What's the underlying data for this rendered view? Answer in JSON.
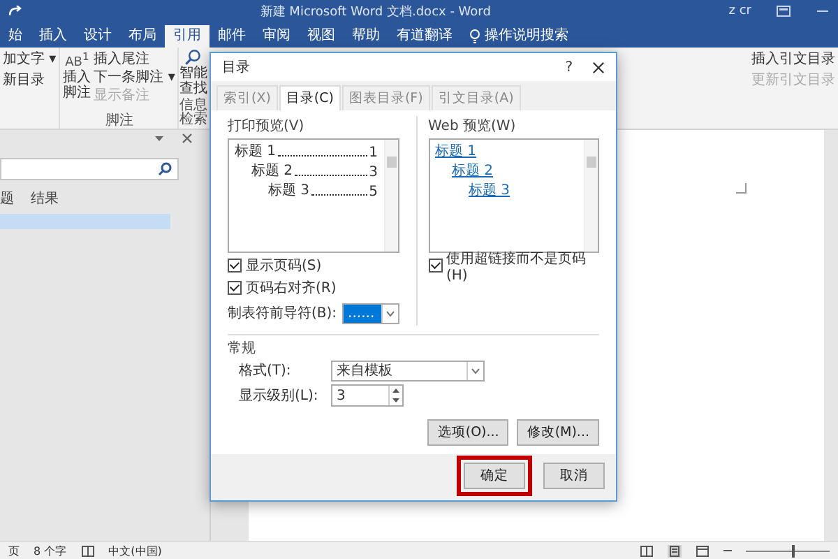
{
  "window": {
    "title": "新建 Microsoft Word 文档.docx  -  Word",
    "user": "z cr"
  },
  "ribbon_tabs": [
    {
      "label": "始",
      "selected": false
    },
    {
      "label": "插入",
      "selected": false
    },
    {
      "label": "设计",
      "selected": false
    },
    {
      "label": "布局",
      "selected": false
    },
    {
      "label": "引用",
      "selected": true
    },
    {
      "label": "邮件",
      "selected": false
    },
    {
      "label": "审阅",
      "selected": false
    },
    {
      "label": "视图",
      "selected": false
    },
    {
      "label": "帮助",
      "selected": false
    },
    {
      "label": "有道翻译",
      "selected": false
    }
  ],
  "tell_me": "操作说明搜索",
  "ribbon": {
    "toc_items": [
      {
        "label": "加文字 ▾",
        "disabled": false
      },
      {
        "label": "新目录",
        "disabled": false
      }
    ],
    "footnote_icon": "AB$^{1}$",
    "footnote_big": "插入脚注",
    "footnote_items": [
      {
        "label": "插入尾注",
        "disabled": false
      },
      {
        "label": "下一条脚注 ▾",
        "disabled": false
      },
      {
        "label": "显示备注",
        "disabled": true
      }
    ],
    "footnote_group": "脚注",
    "lookup": "智能查找",
    "lookup_group": "信息检索",
    "citation_items": [
      {
        "label": "插入引文目录",
        "disabled": false
      },
      {
        "label": "更新引文目录",
        "disabled": true
      }
    ]
  },
  "navigation_pane": {
    "tabs": [
      {
        "label": "题",
        "selected": false
      },
      {
        "label": "结果",
        "selected": false
      }
    ]
  },
  "dialog": {
    "title": "目录",
    "help": "?",
    "tabs": [
      {
        "label": "索引(X)",
        "selected": false
      },
      {
        "label": "目录(C)",
        "selected": true
      },
      {
        "label": "图表目录(F)",
        "selected": false
      },
      {
        "label": "引文目录(A)",
        "selected": false
      }
    ],
    "print_preview": {
      "label": "打印预览(V)",
      "entries": [
        {
          "text": "标题 1",
          "page": "1"
        },
        {
          "text": "标题 2",
          "page": "3"
        },
        {
          "text": "标题 3",
          "page": "5"
        }
      ]
    },
    "web_preview": {
      "label": "Web 预览(W)",
      "entries": [
        "标题 1",
        "标题 2",
        "标题 3"
      ]
    },
    "left_checks": [
      {
        "label": "显示页码(S)",
        "checked": true
      },
      {
        "label": "页码右对齐(R)",
        "checked": true
      }
    ],
    "right_checks": [
      {
        "label": "使用超链接而不是页码(H)",
        "checked": true
      }
    ],
    "leader": {
      "label": "制表符前导符(B):",
      "value": "......"
    },
    "general": {
      "heading": "常规",
      "format_label": "格式(T):",
      "format_value": "来自模板",
      "levels_label": "显示级别(L):",
      "levels_value": "3"
    },
    "options_button": "选项(O)...",
    "modify_button": "修改(M)...",
    "ok_button": {
      "label": "确定",
      "annotated": true
    },
    "cancel_button": "取消"
  },
  "status_bar": {
    "page": "页",
    "words": "8 个字",
    "language": "中文(中国)",
    "zoom_slider": {
      "level": 0.55
    }
  }
}
